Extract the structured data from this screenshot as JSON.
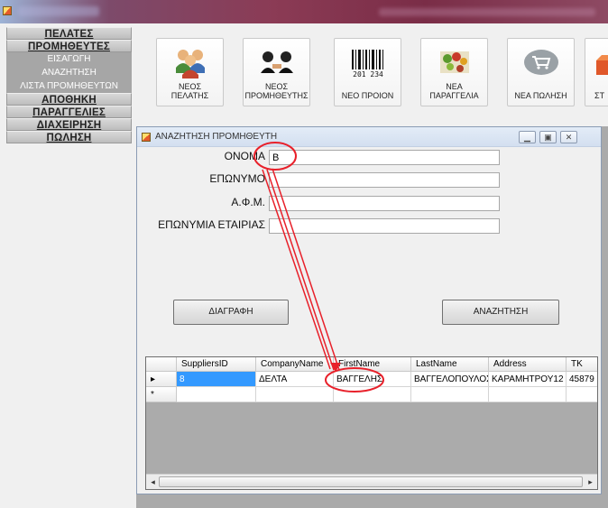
{
  "menu": {
    "customers": "ΠΕΛΑΤΕΣ",
    "suppliers": "ΠΡΟΜΗΘΕΥΤΕΣ",
    "supplier_items": [
      "ΕΙΣΑΓΩΓΗ",
      "ΑΝΑΖΗΤΗΣΗ",
      "ΛΙΣΤΑ ΠΡΟΜΗΘΕΥΤΩΝ"
    ],
    "warehouse": "ΑΠΟΘΗΚΗ",
    "orders": "ΠΑΡΑΓΓΕΛΙΕΣ",
    "management": "ΔΙΑΧΕΙΡΗΣΗ",
    "sale": "ΠΩΛΗΣΗ"
  },
  "toolbar": {
    "new_customer": [
      "ΝΕΟΣ",
      "ΠΕΛΑΤΗΣ"
    ],
    "new_supplier": [
      "ΝΕΟΣ",
      "ΠΡΟΜΗΘΕΥΤΗΣ"
    ],
    "new_product": "ΝΕΟ ΠΡΟΙΟΝ",
    "new_order": [
      "ΝΕΑ",
      "ΠΑΡΑΓΓΕΛΙΑ"
    ],
    "new_sale": "ΝΕΑ ΠΩΛΗΣΗ",
    "partial": "ΣΤ"
  },
  "dialog": {
    "title": "ΑΝΑΖΗΤΗΣΗ ΠΡΟΜΗΘΕΥΤΗ",
    "fields": {
      "first_name_label": "ΟΝΟΜΑ",
      "first_name_value": "B",
      "last_name_label": "ΕΠΩΝΥΜΟ",
      "last_name_value": "",
      "vat_label": "Α.Φ.Μ.",
      "vat_value": "",
      "company_label": "ΕΠΩΝΥΜΙΑ ΕΤΑΙΡΙΑΣ",
      "company_value": ""
    },
    "delete_button": "ΔΙΑΓΡΑΦΗ",
    "search_button": "ΑΝΑΖΗΤΗΣΗ"
  },
  "grid": {
    "columns": [
      "SuppliersID",
      "CompanyName",
      "FirstName",
      "LastName",
      "Address",
      "TK"
    ],
    "rows": [
      [
        "8",
        "ΔΕΛΤΑ",
        "ΒΑΓΓΕΛΗΣ",
        "ΒΑΓΓΕΛΟΠΟΥΛΟΣ",
        "ΚΑΡΑΜΗΤΡΟΥ12",
        "45879"
      ]
    ],
    "new_row_marker": "*",
    "current_row_marker": "▸"
  },
  "colors": {
    "annotation": "#e8202a",
    "menu_sub_bg": "#a6a6a6",
    "selected_cell": "#3399ff"
  },
  "icons": [
    "customers-people-icon",
    "supplier-handshake-icon",
    "barcode-icon",
    "order-produce-icon",
    "shopping-cart-icon",
    "box-icon",
    "minimize-icon",
    "maximize-icon",
    "close-icon"
  ]
}
